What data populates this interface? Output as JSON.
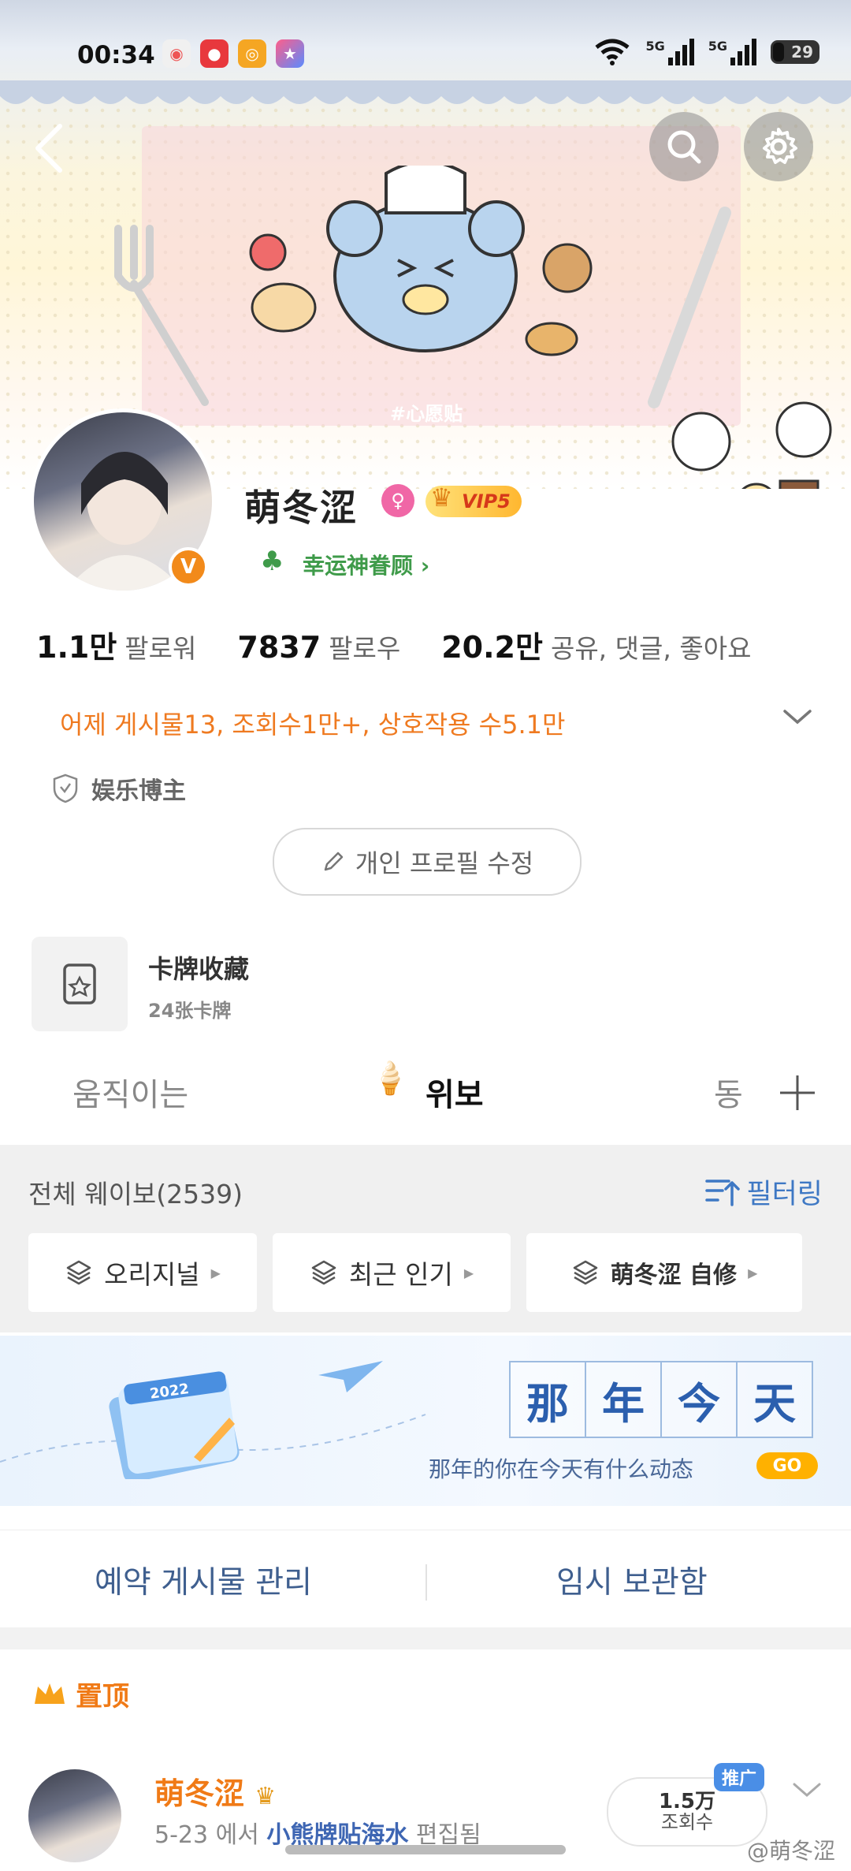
{
  "status_bar": {
    "time": "00:34",
    "network_1": "5G",
    "network_2": "5G",
    "battery": "29"
  },
  "header": {
    "banner_tag": "#心愿贴"
  },
  "profile": {
    "username": "萌冬涩",
    "vip_label": "VIP5",
    "lucky_link": "幸运神眷顾",
    "stats": [
      {
        "value": "1.1만",
        "label": "팔로워"
      },
      {
        "value": "7837",
        "label": "팔로우"
      },
      {
        "value": "20.2만",
        "label": "공유, 댓글, 좋아요"
      }
    ],
    "yesterday_summary": "어제 게시물13, 조회수1만+, 상호작용 수5.1만",
    "tag": "娱乐博主",
    "edit_button": "개인 프로필 수정"
  },
  "cards": {
    "title": "卡牌收藏",
    "subtitle": "24张卡牌"
  },
  "tabs": [
    {
      "label": "움직이는"
    },
    {
      "label": "위보"
    },
    {
      "label": "동"
    }
  ],
  "feed": {
    "count_label": "전체 웨이보(2539)",
    "filter_label": "필터링",
    "chips": [
      "오리지널",
      "최근 인기",
      "萌冬涩 自修"
    ]
  },
  "memory": {
    "title_chars": [
      "那",
      "年",
      "今",
      "天"
    ],
    "subtitle": "那年的你在今天有什么动态",
    "go": "GO",
    "calendar_year": "2022"
  },
  "actions": {
    "scheduled": "예약 게시물 관리",
    "drafts": "임시 보관함"
  },
  "pinned": {
    "label": "置顶",
    "user": "萌冬涩",
    "meta_prefix": "5-23 에서 ",
    "meta_source": "小熊牌贴海水",
    "meta_suffix": " 편집됨",
    "views_number": "1.5万",
    "views_label": "조회수",
    "promo": "推广"
  },
  "watermark": "@萌冬涩",
  "colors": {
    "accent_orange": "#f07a16",
    "link_blue": "#3e78c4",
    "go_yellow": "#ffb100"
  }
}
